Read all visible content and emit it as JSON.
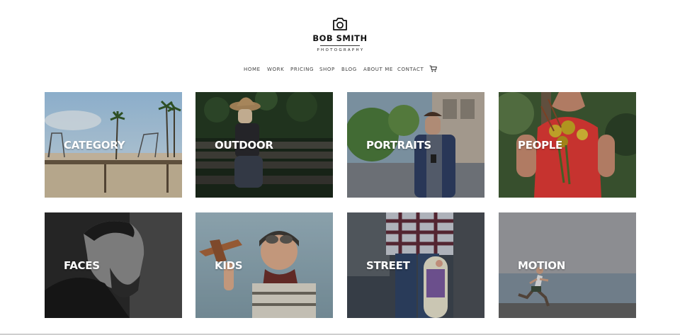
{
  "brand": {
    "name": "BOB SMITH",
    "subtitle": "PHOTOGRAPHY",
    "icon": "camera-icon"
  },
  "nav": {
    "items": [
      {
        "label": "HOME"
      },
      {
        "label": "WORK"
      },
      {
        "label": "PRICING"
      },
      {
        "label": "SHOP"
      },
      {
        "label": "BLOG"
      },
      {
        "label": "ABOUT ME"
      },
      {
        "label": "CONTACT"
      }
    ],
    "cart_icon": "cart-icon"
  },
  "gallery": {
    "tiles": [
      {
        "label": "CATEGORY",
        "image": "beach-playground-photo"
      },
      {
        "label": "OUTDOOR",
        "image": "woman-on-bench-photo"
      },
      {
        "label": "PORTRAITS",
        "image": "man-with-phone-photo"
      },
      {
        "label": "PEOPLE",
        "image": "woman-with-flowers-photo"
      },
      {
        "label": "FACES",
        "image": "bearded-man-photo"
      },
      {
        "label": "KIDS",
        "image": "boy-with-plane-photo"
      },
      {
        "label": "STREET",
        "image": "skateboarder-photo"
      },
      {
        "label": "MOTION",
        "image": "runner-photo"
      }
    ]
  },
  "colors": {
    "text": "#444444",
    "label": "#ffffff"
  }
}
